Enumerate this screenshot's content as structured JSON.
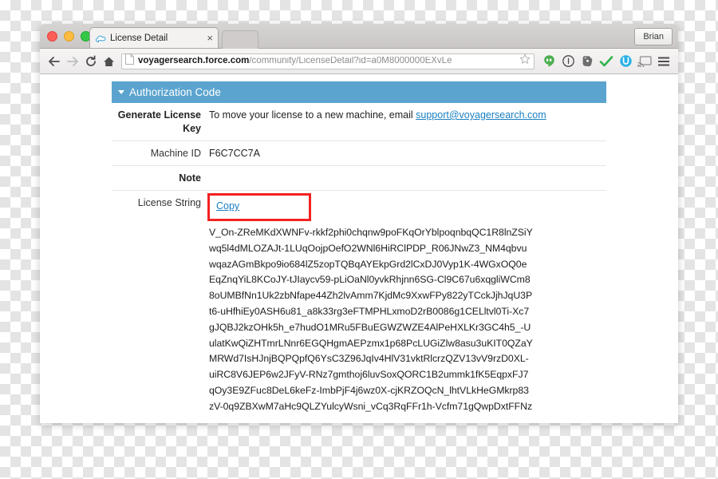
{
  "window": {
    "traffic_lights": [
      "close",
      "minimize",
      "maximize"
    ],
    "user_button_label": "Brian",
    "tab": {
      "title": "License Detail",
      "close_label": "×"
    }
  },
  "toolbar": {
    "back_label": "Back",
    "forward_label": "Forward",
    "reload_label": "Reload",
    "home_label": "Home",
    "url_host": "voyagersearch.force.com",
    "url_path": "/community/LicenseDetail?id=a0M8000000EXvLe",
    "url_full": "voyagersearch.force.com/community/LicenseDetail?id=a0M8000000EXvLe",
    "extensions": [
      "hangouts-icon",
      "info-circle-icon",
      "evernote-icon",
      "checkmark-icon",
      "ublock-icon",
      "cast-icon",
      "menu-icon"
    ]
  },
  "page": {
    "section_title": "Authorization Code",
    "section_color": "#5ba4cf",
    "rows": [
      {
        "label": "Generate License Key",
        "bold": true,
        "text_before": "To move your license to a new machine, email ",
        "link": "support@voyagersearch.com"
      },
      {
        "label": "Machine ID",
        "bold": false,
        "value": "F6C7CC7A"
      },
      {
        "label": "Note",
        "bold": true,
        "value": ""
      },
      {
        "label": "License String",
        "bold": false,
        "copy_link": "Copy",
        "highlight_color": "#f42121"
      }
    ],
    "license_string_lines": [
      "V_On-ZReMKdXWNFv-rkkf2phi0chqnw9poFKqOrYblpoqnbqQC1R8lnZSiY",
      "wq5l4dMLOZAJt-1LUqOojpOefO2WNl6HiRClPDP_R06JNwZ3_NM4qbvu",
      "wqazAGmBkpo9io684lZ5zopTQBqAYEkpGrd2lCxDJ0Vyp1K-4WGxOQ0e",
      "EqZnqYiL8KCoJY-tJIaycv59-pLiOaNl0yvkRhjnn6SG-Cl9C67u6xqgliWCm8",
      "8oUMBfNn1Uk2zbNfape44Zh2lvAmm7KjdMc9XxwFPy822yTCckJjhJqU3P",
      "t6-uHfhiEy0ASH6u81_a8k33rg3eFTMPHLxmoD2rB0086g1CELltvl0Ti-Xc7",
      "gJQBJ2kzOHk5h_e7hudO1MRu5FBuEGWZWZE4AlPeHXLKr3GC4h5_-U",
      "ulatKwQiZHTmrLNnr6EGQHgmAEPzmx1p68PcLUGiZlw8asu3uKIT0QZaY",
      "MRWd7IsHJnjBQPQpfQ6YsC3Z96JqIv4HlV31vktRlcrzQZV13vV9rzD0XL-",
      "uiRC8V6JEP6w2JFyV-RNz7gmthoj6luvSoxQORC1B2ummk1fK5EqpxFJ7",
      "qOy3E9ZFuc8DeL6keFz-ImbPjF4j6wz0X-cjKRZOQcN_lhtVLkHeGMkrp83",
      "zV-0q9ZBXwM7aHc9QLZYulcyWsni_vCq3RqFFr1h-Vcfm71gQwpDxtFFNz"
    ]
  }
}
